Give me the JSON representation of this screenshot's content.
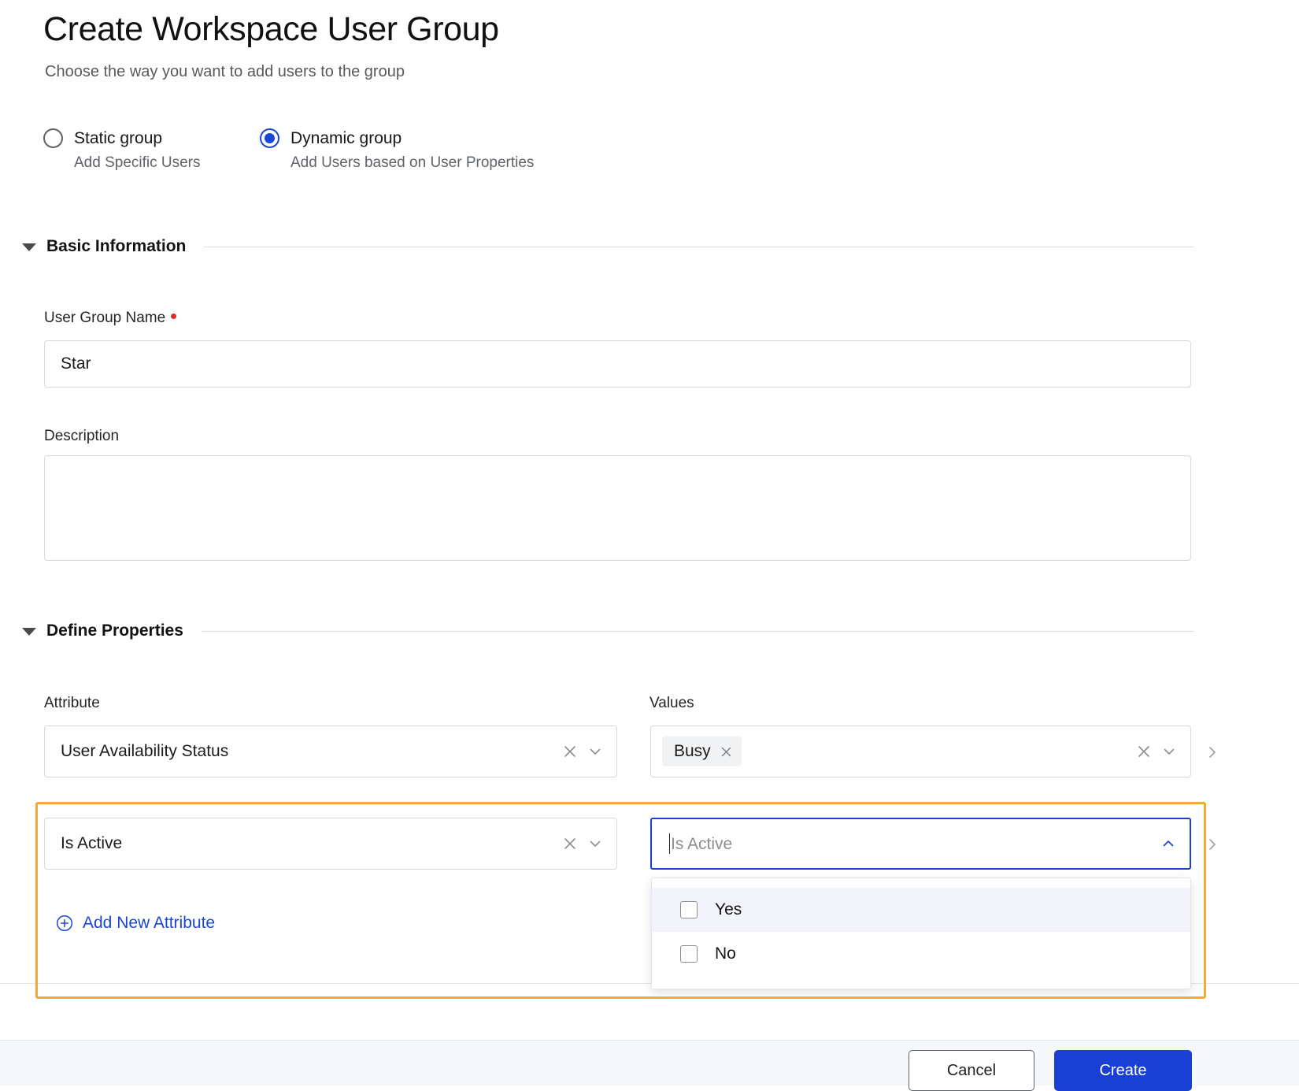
{
  "header": {
    "title": "Create Workspace User Group",
    "subtitle": "Choose the way you want to add users to the group"
  },
  "group_type": {
    "options": [
      {
        "label": "Static group",
        "description": "Add Specific Users",
        "selected": false
      },
      {
        "label": "Dynamic group",
        "description": "Add Users based on User Properties",
        "selected": true
      }
    ]
  },
  "sections": {
    "basic_information": {
      "title": "Basic Information",
      "name_field": {
        "label": "User Group Name",
        "required_marker": "•",
        "value": "Star",
        "placeholder": ""
      },
      "description_field": {
        "label": "Description",
        "value": "",
        "placeholder": ""
      }
    },
    "define_properties": {
      "title": "Define Properties",
      "column_headers": {
        "attribute": "Attribute",
        "values": "Values"
      },
      "rows": [
        {
          "attribute": "User Availability Status",
          "attribute_placeholder": "",
          "values_chips": [
            "Busy"
          ],
          "values_placeholder": "",
          "expanded": false,
          "highlighted": false
        },
        {
          "attribute": "Is Active",
          "attribute_placeholder": "",
          "values_chips": [],
          "values_placeholder": "Is Active",
          "expanded": true,
          "highlighted": true
        }
      ],
      "add_attribute_label": "Add New Attribute"
    }
  },
  "dropdown": {
    "open": true,
    "items": [
      {
        "label": "Yes",
        "checked": false,
        "highlighted": true
      },
      {
        "label": "No",
        "checked": false,
        "highlighted": false
      }
    ]
  },
  "footer": {
    "cancel_label": "Cancel",
    "submit_label": "Create"
  },
  "icons": {
    "clear": "close-x-icon",
    "chevron_down": "chevron-down-icon",
    "chevron_up": "chevron-up-icon",
    "chevron_right": "chevron-right-icon",
    "plus_circle": "plus-circle-icon",
    "collapse_caret": "caret-down-icon"
  },
  "colors": {
    "accent": "#1a3fd4",
    "link": "#1a45d6",
    "highlight_border": "#f2a83c",
    "required": "#d93025",
    "chip_bg": "#f1f2f4"
  }
}
